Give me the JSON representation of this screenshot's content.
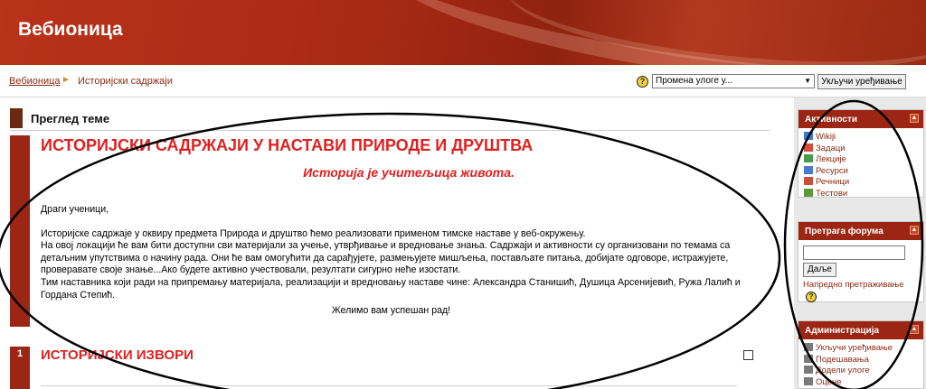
{
  "header": {
    "title": "Вебионица"
  },
  "breadcrumb": {
    "home": "Вебионица",
    "separator": "►",
    "current": "Историјски садржаји"
  },
  "navbar": {
    "help_glyph": "?",
    "role_select_value": "Промена улоге у...",
    "edit_button": "Укључи уређивање"
  },
  "topic_overview": {
    "title": "Преглед теме"
  },
  "section0": {
    "title": "ИСТОРИЈСКИ САДРЖАЈИ У НАСТАВИ ПРИРОДЕ И ДРУШТВА",
    "subtitle": "Историја је учитељица живота.",
    "greeting": "Драги ученици,",
    "p1": "Историјске садржаје у оквиру предмета Природа и друштво ћемо реализовати применом тимске наставе у веб-окружењу.",
    "p2": "На овој локацији ће вам бити доступни сви материјали за учење, утврђивање и вредновање знања. Садржаји и активности су организовани по темама са детаљним упутствима о начину рада. Они ће вам омогућити да сарађујете, размењујете мишљења, постављате питања, добијате одговоре, истражујете, проверавате своје знање...Ако будете активно учествовали, резултати сигурно неће изостати.",
    "p3": "Тим наставника који ради на припремању материјала, реализацији и вредновању наставе чине: Александра Станишић, Душица Арсенијевић, Ружа Лалић и Гордана Степић.",
    "closing": "Желимо вам успешан рад!"
  },
  "section1": {
    "number": "1",
    "title": "ИСТОРИЈСКИ ИЗВОРИ"
  },
  "blocks": {
    "activities": {
      "title": "Активности",
      "items": [
        {
          "label": "Wikiji",
          "icon": "wiki-icon"
        },
        {
          "label": "Задаци",
          "icon": "assignment-icon"
        },
        {
          "label": "Лекције",
          "icon": "lesson-icon"
        },
        {
          "label": "Ресурси",
          "icon": "resource-icon"
        },
        {
          "label": "Речници",
          "icon": "glossary-icon"
        },
        {
          "label": "Тестови",
          "icon": "quiz-icon"
        }
      ]
    },
    "forum_search": {
      "title": "Претрага форума",
      "button": "Даље",
      "advanced": "Напредно претраживање",
      "help_glyph": "?"
    },
    "admin": {
      "title": "Администрација",
      "items": [
        {
          "label": "Укључи уређивање"
        },
        {
          "label": "Подешавања"
        },
        {
          "label": "Додели улоге"
        },
        {
          "label": "Оцене"
        }
      ]
    },
    "collapse_glyph": "▲"
  },
  "colors": {
    "header": "#a82a14",
    "section_bar": "#9b2614",
    "heading_red": "#e02020",
    "link": "#8b2a12"
  }
}
